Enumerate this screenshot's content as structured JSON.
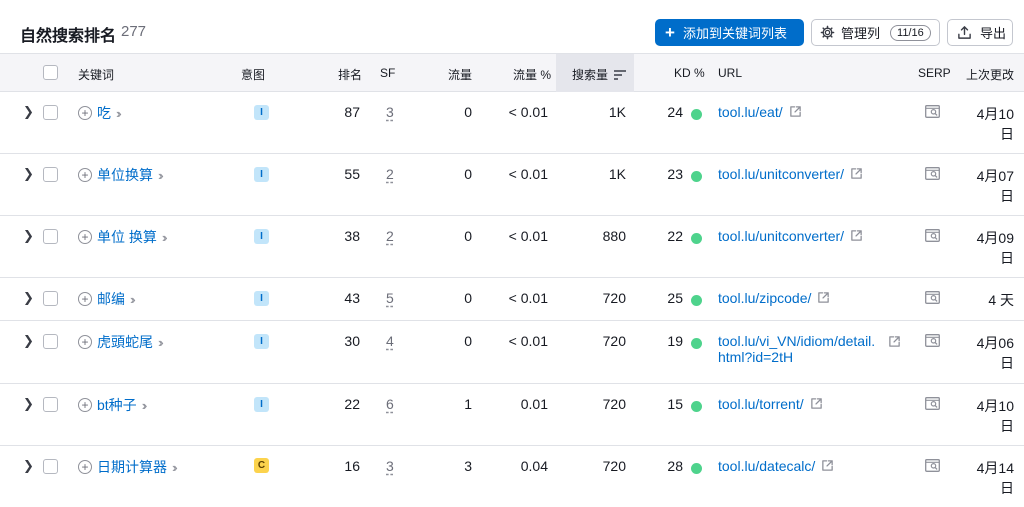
{
  "header": {
    "title": "自然搜索排名",
    "count": "277",
    "add_button": "添加到关键词列表",
    "manage_cols": "管理列",
    "cols_badge": "11/16",
    "export": "导出"
  },
  "columns": {
    "keyword": "关键词",
    "intent": "意图",
    "rank": "排名",
    "sf": "SF",
    "traffic": "流量",
    "traffic_pct": "流量 %",
    "volume": "搜索量",
    "kd": "KD %",
    "url": "URL",
    "serp": "SERP",
    "updated": "上次更改"
  },
  "rows": [
    {
      "keyword": "吃",
      "intent": "I",
      "rank": "87",
      "sf": "3",
      "traffic": "0",
      "traffic_pct": "< 0.01",
      "volume": "1K",
      "kd": "24",
      "url": "tool.lu/eat/",
      "url2": "",
      "date": "4月10",
      "date2": "日"
    },
    {
      "keyword": "单位换算",
      "intent": "I",
      "rank": "55",
      "sf": "2",
      "traffic": "0",
      "traffic_pct": "< 0.01",
      "volume": "1K",
      "kd": "23",
      "url": "tool.lu/unitconverter/",
      "url2": "",
      "date": "4月07",
      "date2": "日"
    },
    {
      "keyword": "单位 换算",
      "intent": "I",
      "rank": "38",
      "sf": "2",
      "traffic": "0",
      "traffic_pct": "< 0.01",
      "volume": "880",
      "kd": "22",
      "url": "tool.lu/unitconverter/",
      "url2": "",
      "date": "4月09",
      "date2": "日"
    },
    {
      "keyword": "邮编",
      "intent": "I",
      "rank": "43",
      "sf": "5",
      "traffic": "0",
      "traffic_pct": "< 0.01",
      "volume": "720",
      "kd": "25",
      "url": "tool.lu/zipcode/",
      "url2": "",
      "date": "4 天",
      "date2": ""
    },
    {
      "keyword": "虎頭蛇尾",
      "intent": "I",
      "rank": "30",
      "sf": "4",
      "traffic": "0",
      "traffic_pct": "< 0.01",
      "volume": "720",
      "kd": "19",
      "url": "tool.lu/vi_VN/idiom/detail.",
      "url2": "html?id=2tH",
      "date": "4月06",
      "date2": "日"
    },
    {
      "keyword": "bt种子",
      "intent": "I",
      "rank": "22",
      "sf": "6",
      "traffic": "1",
      "traffic_pct": "0.01",
      "volume": "720",
      "kd": "15",
      "url": "tool.lu/torrent/",
      "url2": "",
      "date": "4月10",
      "date2": "日"
    },
    {
      "keyword": "日期计算器",
      "intent": "C",
      "rank": "16",
      "sf": "3",
      "traffic": "3",
      "traffic_pct": "0.04",
      "volume": "720",
      "kd": "28",
      "url": "tool.lu/datecalc/",
      "url2": "",
      "date": "4月14",
      "date2": "日"
    }
  ],
  "colors": {
    "accent": "#006dca",
    "kd_dot": "#4ed38c",
    "intent_i": "#c2e5fa",
    "intent_c": "#fcd34d"
  }
}
